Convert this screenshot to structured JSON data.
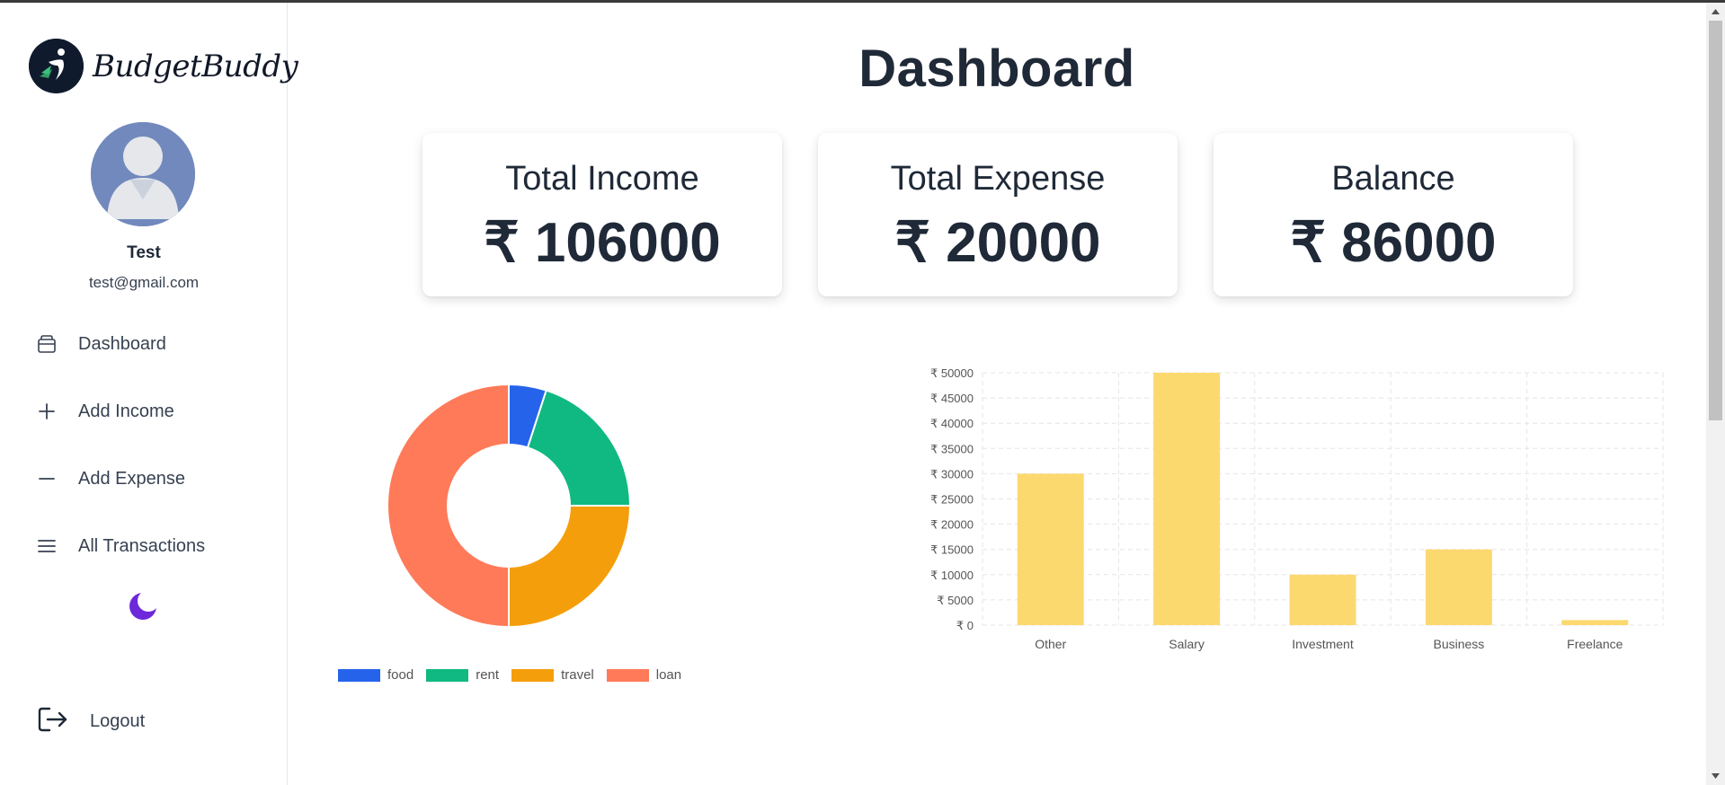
{
  "app": {
    "brand_name": "BudgetBuddy",
    "brand_icon": "budgetbuddy-logo"
  },
  "user": {
    "name": "Test",
    "email": "test@gmail.com",
    "avatar_icon": "user-avatar-icon"
  },
  "nav": {
    "items": [
      {
        "label": "Dashboard",
        "icon": "wallet-icon"
      },
      {
        "label": "Add Income",
        "icon": "plus-icon"
      },
      {
        "label": "Add Expense",
        "icon": "minus-icon"
      },
      {
        "label": "All Transactions",
        "icon": "list-icon"
      }
    ],
    "theme_toggle_icon": "moon-icon",
    "logout_label": "Logout",
    "logout_icon": "logout-icon"
  },
  "page": {
    "title": "Dashboard"
  },
  "summary": {
    "income_label": "Total Income",
    "income_value": "₹ 106000",
    "expense_label": "Total Expense",
    "expense_value": "₹ 20000",
    "balance_label": "Balance",
    "balance_value": "₹ 86000"
  },
  "colors": {
    "food": "#2563eb",
    "rent": "#10b981",
    "travel": "#f59e0b",
    "loan": "#ff7a59",
    "bar": "#fcd96f",
    "text_dark": "#1f2937",
    "moon": "#6d28d9"
  },
  "chart_data": [
    {
      "type": "pie",
      "variant": "doughnut",
      "categories": [
        "food",
        "rent",
        "travel",
        "loan"
      ],
      "values": [
        1000,
        4000,
        5000,
        10000
      ],
      "legend": "bottom"
    },
    {
      "type": "bar",
      "categories": [
        "Other",
        "Salary",
        "Investment",
        "Business",
        "Freelance"
      ],
      "values": [
        30000,
        50000,
        10000,
        15000,
        1000
      ],
      "ylim": [
        0,
        50000
      ],
      "ytick_step": 5000,
      "ytick_prefix": "₹ ",
      "grid": "dashed",
      "legend": "none"
    }
  ]
}
